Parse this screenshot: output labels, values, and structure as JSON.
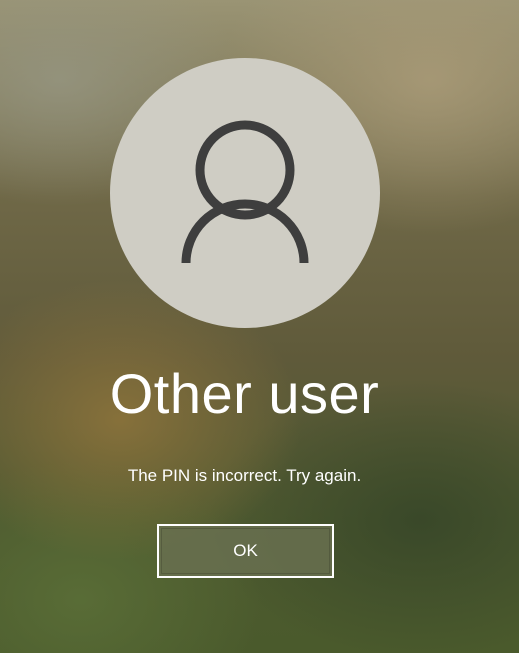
{
  "user": {
    "name": "Other user",
    "avatar_icon": "person-icon"
  },
  "message": "The PIN is incorrect. Try again.",
  "ok_button": {
    "label": "OK"
  },
  "colors": {
    "avatar_bg": "#cfcdc4",
    "avatar_glyph": "#3e3e3e",
    "text": "#ffffff",
    "button_border": "#ffffff"
  }
}
